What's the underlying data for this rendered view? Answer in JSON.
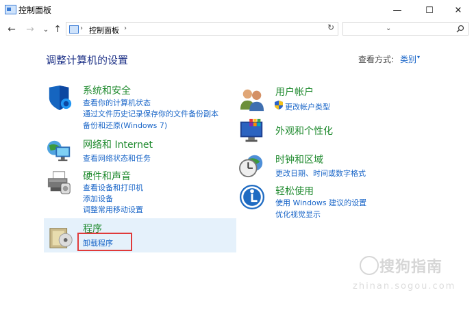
{
  "window": {
    "title": "控制面板",
    "minimize": "—",
    "maximize": "☐",
    "close": "✕"
  },
  "nav": {
    "back": "←",
    "forward": "→",
    "recent": "⌄",
    "up": "↑"
  },
  "address": {
    "path_label": "控制面板",
    "sep1": "›",
    "sep2": "›",
    "dropdown": "⌄",
    "refresh": "↻"
  },
  "search": {
    "placeholder": ""
  },
  "main": {
    "heading": "调整计算机的设置",
    "view_by_label": "查看方式:",
    "view_by_value": "类别",
    "view_by_arrow": "▾"
  },
  "categories_left": [
    {
      "title": "系统和安全",
      "icon": "shield-icon",
      "links": [
        "查看你的计算机状态",
        "通过文件历史记录保存你的文件备份副本",
        "备份和还原(Windows 7)"
      ]
    },
    {
      "title": "网络和 Internet",
      "icon": "network-icon",
      "links": [
        "查看网络状态和任务"
      ]
    },
    {
      "title": "硬件和声音",
      "icon": "printer-icon",
      "links": [
        "查看设备和打印机",
        "添加设备",
        "调整常用移动设置"
      ]
    },
    {
      "title": "程序",
      "icon": "programs-icon",
      "links": [
        "卸载程序"
      ]
    }
  ],
  "categories_right": [
    {
      "title": "用户帐户",
      "icon": "users-icon",
      "links": [
        "更改帐户类型"
      ]
    },
    {
      "title": "外观和个性化",
      "icon": "appearance-icon",
      "links": []
    },
    {
      "title": "时钟和区域",
      "icon": "clock-icon",
      "links": [
        "更改日期、时间或数字格式"
      ]
    },
    {
      "title": "轻松使用",
      "icon": "ease-of-access-icon",
      "links": [
        "使用 Windows 建议的设置",
        "优化视觉显示"
      ]
    }
  ],
  "watermark": {
    "text": "搜狗指南",
    "url": "zhinan.sogou.com"
  }
}
